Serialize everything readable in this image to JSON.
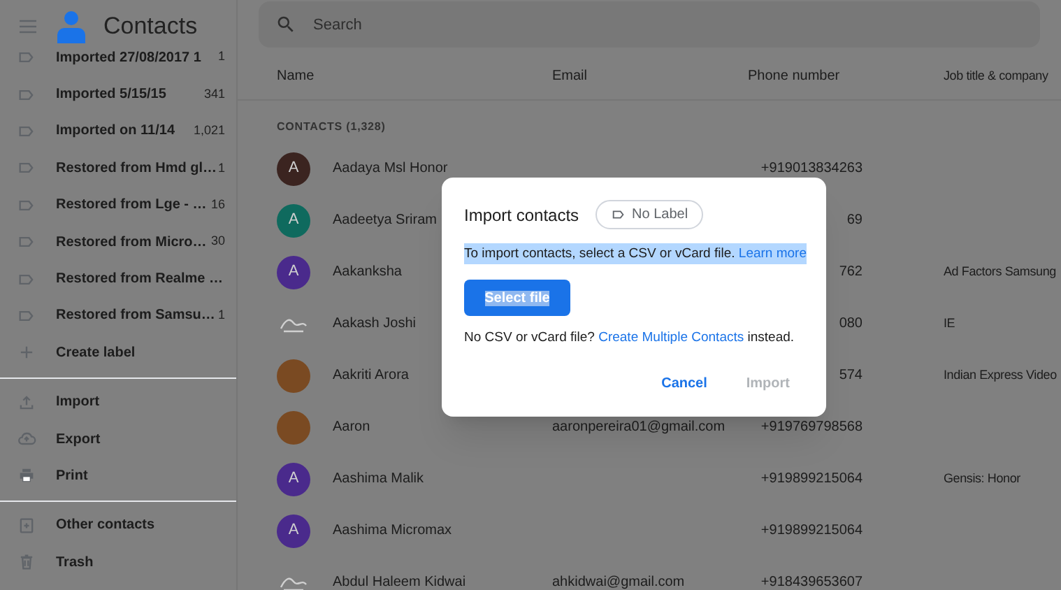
{
  "app": {
    "title": "Contacts"
  },
  "search": {
    "placeholder": "Search"
  },
  "sidebar": {
    "labels": [
      {
        "label": "Imported 27/08/2017 1",
        "count": "1"
      },
      {
        "label": "Imported 5/15/15",
        "count": "341"
      },
      {
        "label": "Imported on 11/14",
        "count": "1,021"
      },
      {
        "label": "Restored from Hmd gl…",
        "count": "1"
      },
      {
        "label": "Restored from Lge - …",
        "count": "16"
      },
      {
        "label": "Restored from Micro…",
        "count": "30"
      },
      {
        "label": "Restored from Realme …"
      },
      {
        "label": "Restored from Samsu…",
        "count": "1"
      }
    ],
    "create_label": "Create label",
    "actions": [
      {
        "kind": "import",
        "label": "Import"
      },
      {
        "kind": "export",
        "label": "Export"
      },
      {
        "kind": "print",
        "label": "Print"
      }
    ],
    "other": [
      {
        "kind": "other",
        "label": "Other contacts"
      },
      {
        "kind": "trash",
        "label": "Trash"
      }
    ]
  },
  "table": {
    "columns": [
      "Name",
      "Email",
      "Phone number",
      "Job title & company"
    ],
    "section": "CONTACTS (1,328)",
    "rows": [
      {
        "kind": "letter",
        "letter": "A",
        "color": "#3b2420",
        "name": "Aadaya Msl Honor",
        "phone": "+919013834263"
      },
      {
        "kind": "letter",
        "letter": "A",
        "color": "#0f6a5e",
        "name": "Aadeetya Sriram",
        "phone": "69"
      },
      {
        "kind": "letter",
        "letter": "A",
        "color": "#4a2a8c",
        "name": "Aakanksha",
        "phone": "762",
        "job": "Ad Factors Samsung"
      },
      {
        "kind": "sketch",
        "name": "Aakash Joshi",
        "phone": "080",
        "job": "IE"
      },
      {
        "kind": "photo",
        "name": "Aakriti Arora",
        "phone": "574",
        "job": "Indian Express Video"
      },
      {
        "kind": "photo",
        "name": "Aaron",
        "email": "aaronpereira01@gmail.com",
        "phone": "+919769798568"
      },
      {
        "kind": "letter",
        "letter": "A",
        "color": "#4a2a8c",
        "name": "Aashima Malik",
        "phone": "+919899215064",
        "job": "Gensis: Honor"
      },
      {
        "kind": "letter",
        "letter": "A",
        "color": "#4a2a8c",
        "name": "Aashima Micromax",
        "phone": "+919899215064"
      },
      {
        "kind": "sketch",
        "name": "Abdul Haleem Kidwai",
        "email": "ahkidwai@gmail.com",
        "phone": "+918439653607"
      }
    ]
  },
  "dialog": {
    "title": "Import contacts",
    "label_chip": "No Label",
    "description": {
      "text": "To import contacts, select a CSV or vCard file.",
      "link": "Learn more",
      "highlighted": true
    },
    "select_button": {
      "label": "Select file",
      "highlighted": true
    },
    "footer": {
      "before": "No CSV or vCard file?",
      "link": "Create Multiple Contacts",
      "after": "instead."
    },
    "buttons": [
      {
        "label": "Cancel",
        "disabled": false
      },
      {
        "label": "Import",
        "disabled": true
      }
    ]
  }
}
